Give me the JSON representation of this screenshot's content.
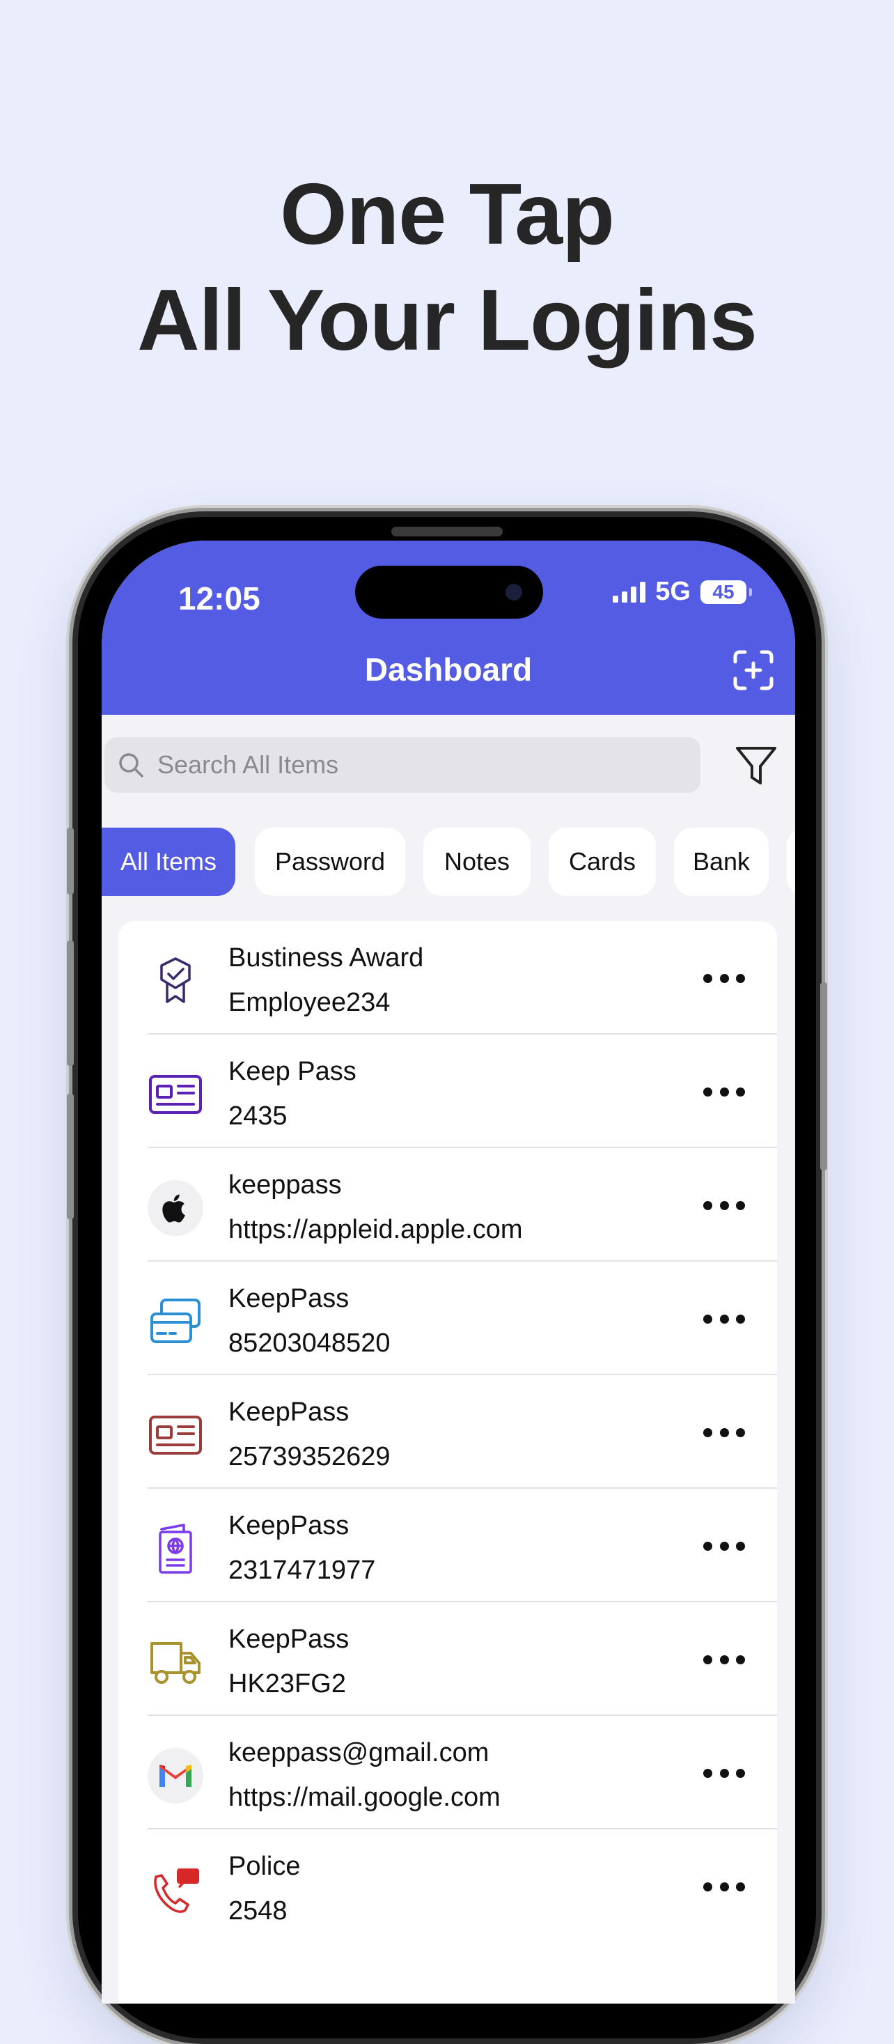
{
  "headline": {
    "line1": "One Tap",
    "line2": "All Your Logins"
  },
  "status_bar": {
    "time": "12:05",
    "network": "5G",
    "battery": "45"
  },
  "header": {
    "title": "Dashboard",
    "scan_icon": "scan-add-icon"
  },
  "search": {
    "placeholder": "Search All Items",
    "filter_icon": "filter-icon"
  },
  "categories": [
    "All Items",
    "Password",
    "Notes",
    "Cards",
    "Bank"
  ],
  "selected_category": "All Items",
  "colors": {
    "accent": "#535CE2",
    "background": "#E9EDFC",
    "list_background": "#F2F2F7"
  },
  "items": [
    {
      "title": "Bustiness Award",
      "subtitle": "Employee234",
      "icon": "award-badge-icon"
    },
    {
      "title": "Keep Pass",
      "subtitle": "2435",
      "icon": "id-card-icon"
    },
    {
      "title": "keeppass",
      "subtitle": "https://appleid.apple.com",
      "icon": "apple-logo-icon"
    },
    {
      "title": "KeepPass",
      "subtitle": "85203048520",
      "icon": "credit-cards-icon"
    },
    {
      "title": "KeepPass",
      "subtitle": "25739352629",
      "icon": "id-card-icon"
    },
    {
      "title": "KeepPass",
      "subtitle": "2317471977",
      "icon": "passport-icon"
    },
    {
      "title": "KeepPass",
      "subtitle": "HK23FG2",
      "icon": "truck-icon"
    },
    {
      "title": "keeppass@gmail.com",
      "subtitle": "https://mail.google.com",
      "icon": "gmail-logo-icon"
    },
    {
      "title": "Police",
      "subtitle": "2548",
      "icon": "sos-phone-icon"
    }
  ]
}
